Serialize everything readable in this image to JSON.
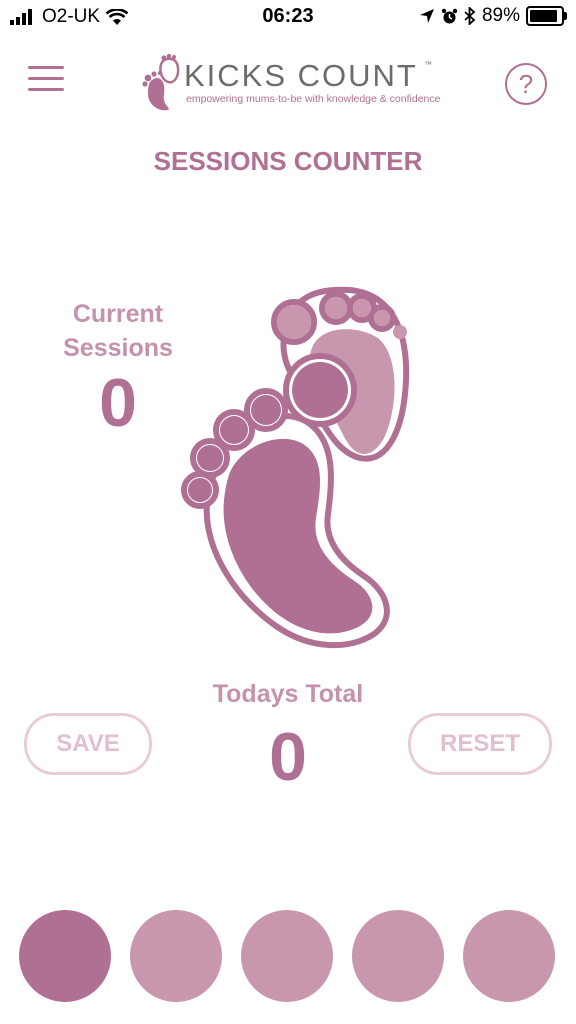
{
  "status": {
    "carrier": "O2-UK",
    "time": "06:23",
    "battery_percent": "89%",
    "battery_level": 0.89,
    "icons": [
      "signal-icon",
      "wifi-icon",
      "location-icon",
      "alarm-icon",
      "bluetooth-icon",
      "battery-icon"
    ]
  },
  "header": {
    "menu_icon": "hamburger-menu-icon",
    "help_icon": "help-icon",
    "help_glyph": "?",
    "logo": {
      "title": "KICKS COUNT",
      "tm": "™",
      "tagline": "empowering mums-to-be with knowledge & confidence"
    }
  },
  "page_title": "SESSIONS COUNTER",
  "current_sessions": {
    "label_line1": "Current",
    "label_line2": "Sessions",
    "value": "0"
  },
  "todays_total": {
    "label": "Todays Total",
    "value": "0"
  },
  "buttons": {
    "save": "SAVE",
    "reset": "RESET"
  },
  "colors": {
    "primary": "#b07094",
    "light": "#c592ad",
    "pale": "#e7ccda",
    "foot_dark": "#b07094",
    "foot_light": "#c897ae",
    "dot_active": "#b07094",
    "dot_inactive": "#c897ae"
  },
  "page_dots": [
    {
      "active": true
    },
    {
      "active": false
    },
    {
      "active": false
    },
    {
      "active": false
    },
    {
      "active": false
    }
  ]
}
